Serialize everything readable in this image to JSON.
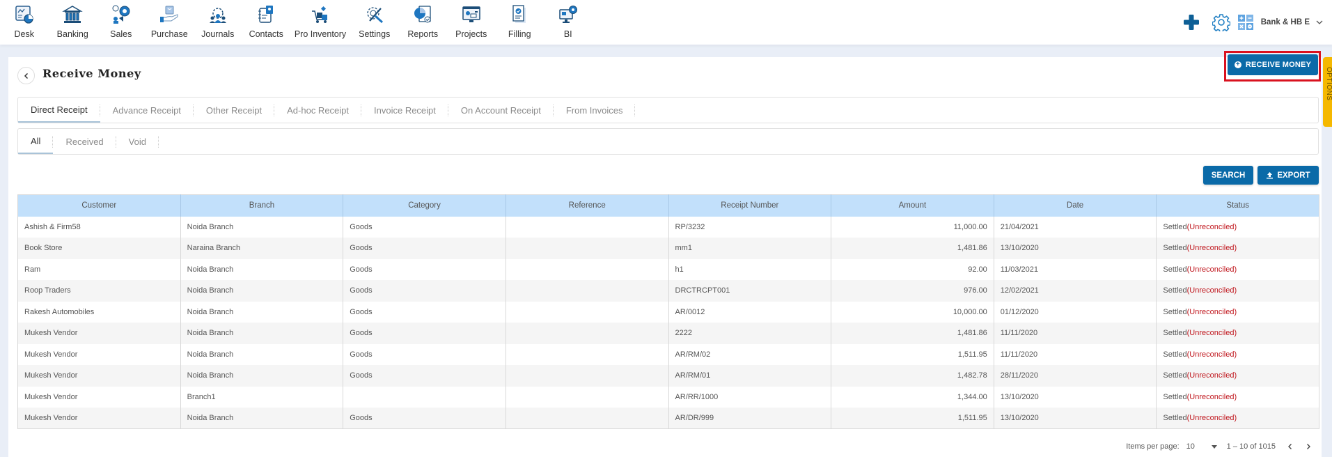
{
  "nav": {
    "items": [
      {
        "label": "Desk",
        "icon": "desk-icon"
      },
      {
        "label": "Banking",
        "icon": "bank-icon"
      },
      {
        "label": "Sales",
        "icon": "sales-icon"
      },
      {
        "label": "Purchase",
        "icon": "purchase-icon"
      },
      {
        "label": "Journals",
        "icon": "journals-icon"
      },
      {
        "label": "Contacts",
        "icon": "contacts-icon"
      },
      {
        "label": "Pro Inventory",
        "icon": "inventory-icon"
      },
      {
        "label": "Settings",
        "icon": "settings-icon"
      },
      {
        "label": "Reports",
        "icon": "reports-icon"
      },
      {
        "label": "Projects",
        "icon": "projects-icon"
      },
      {
        "label": "Filling",
        "icon": "filling-icon"
      },
      {
        "label": "BI",
        "icon": "bi-icon"
      }
    ],
    "company": "Bank & HB E"
  },
  "page": {
    "title": "Receive Money",
    "receive_button": "RECEIVE MONEY",
    "options_label": "OPTIONS"
  },
  "tabs": [
    {
      "label": "Direct Receipt",
      "active": true
    },
    {
      "label": "Advance Receipt"
    },
    {
      "label": "Other Receipt"
    },
    {
      "label": "Ad-hoc Receipt"
    },
    {
      "label": "Invoice Receipt"
    },
    {
      "label": "On Account Receipt"
    },
    {
      "label": "From Invoices"
    }
  ],
  "subtabs": [
    {
      "label": "All",
      "active": true
    },
    {
      "label": "Received"
    },
    {
      "label": "Void"
    }
  ],
  "actions": {
    "search": "SEARCH",
    "export": "EXPORT"
  },
  "table": {
    "columns": [
      "Customer",
      "Branch",
      "Category",
      "Reference",
      "Receipt Number",
      "Amount",
      "Date",
      "Status"
    ],
    "rows": [
      {
        "customer": "Ashish & Firm58",
        "branch": "Noida Branch",
        "category": "Goods",
        "reference": "",
        "receipt": "RP/3232",
        "amount": "11,000.00",
        "date": "21/04/2021",
        "status": "Settled",
        "status_note": "(Unreconciled)"
      },
      {
        "customer": "Book Store",
        "branch": "Naraina Branch",
        "category": "Goods",
        "reference": "",
        "receipt": "mm1",
        "amount": "1,481.86",
        "date": "13/10/2020",
        "status": "Settled",
        "status_note": "(Unreconciled)"
      },
      {
        "customer": "Ram",
        "branch": "Noida Branch",
        "category": "Goods",
        "reference": "",
        "receipt": "h1",
        "amount": "92.00",
        "date": "11/03/2021",
        "status": "Settled",
        "status_note": "(Unreconciled)"
      },
      {
        "customer": "Roop Traders",
        "branch": "Noida Branch",
        "category": "Goods",
        "reference": "",
        "receipt": "DRCTRCPT001",
        "amount": "976.00",
        "date": "12/02/2021",
        "status": "Settled",
        "status_note": "(Unreconciled)"
      },
      {
        "customer": "Rakesh Automobiles",
        "branch": "Noida Branch",
        "category": "Goods",
        "reference": "",
        "receipt": "AR/0012",
        "amount": "10,000.00",
        "date": "01/12/2020",
        "status": "Settled",
        "status_note": "(Unreconciled)"
      },
      {
        "customer": "Mukesh Vendor",
        "branch": "Noida Branch",
        "category": "Goods",
        "reference": "",
        "receipt": "2222",
        "amount": "1,481.86",
        "date": "11/11/2020",
        "status": "Settled",
        "status_note": "(Unreconciled)"
      },
      {
        "customer": "Mukesh Vendor",
        "branch": "Noida Branch",
        "category": "Goods",
        "reference": "",
        "receipt": "AR/RM/02",
        "amount": "1,511.95",
        "date": "11/11/2020",
        "status": "Settled",
        "status_note": "(Unreconciled)"
      },
      {
        "customer": "Mukesh Vendor",
        "branch": "Noida Branch",
        "category": "Goods",
        "reference": "",
        "receipt": "AR/RM/01",
        "amount": "1,482.78",
        "date": "28/11/2020",
        "status": "Settled",
        "status_note": "(Unreconciled)"
      },
      {
        "customer": "Mukesh Vendor",
        "branch": "Branch1",
        "category": "",
        "reference": "",
        "receipt": "AR/RR/1000",
        "amount": "1,344.00",
        "date": "13/10/2020",
        "status": "Settled",
        "status_note": "(Unreconciled)"
      },
      {
        "customer": "Mukesh Vendor",
        "branch": "Noida Branch",
        "category": "Goods",
        "reference": "",
        "receipt": "AR/DR/999",
        "amount": "1,511.95",
        "date": "13/10/2020",
        "status": "Settled",
        "status_note": "(Unreconciled)"
      }
    ]
  },
  "pager": {
    "items_per_page_label": "Items per page:",
    "items_per_page": "10",
    "range": "1 – 10 of 1015"
  },
  "colors": {
    "primary": "#0a6aa8",
    "header_bg": "#c2e0fb",
    "link": "#1a6aa0",
    "unreconciled": "#c0161d",
    "options_tab": "#f5b800",
    "highlight_border": "#d9121f"
  }
}
